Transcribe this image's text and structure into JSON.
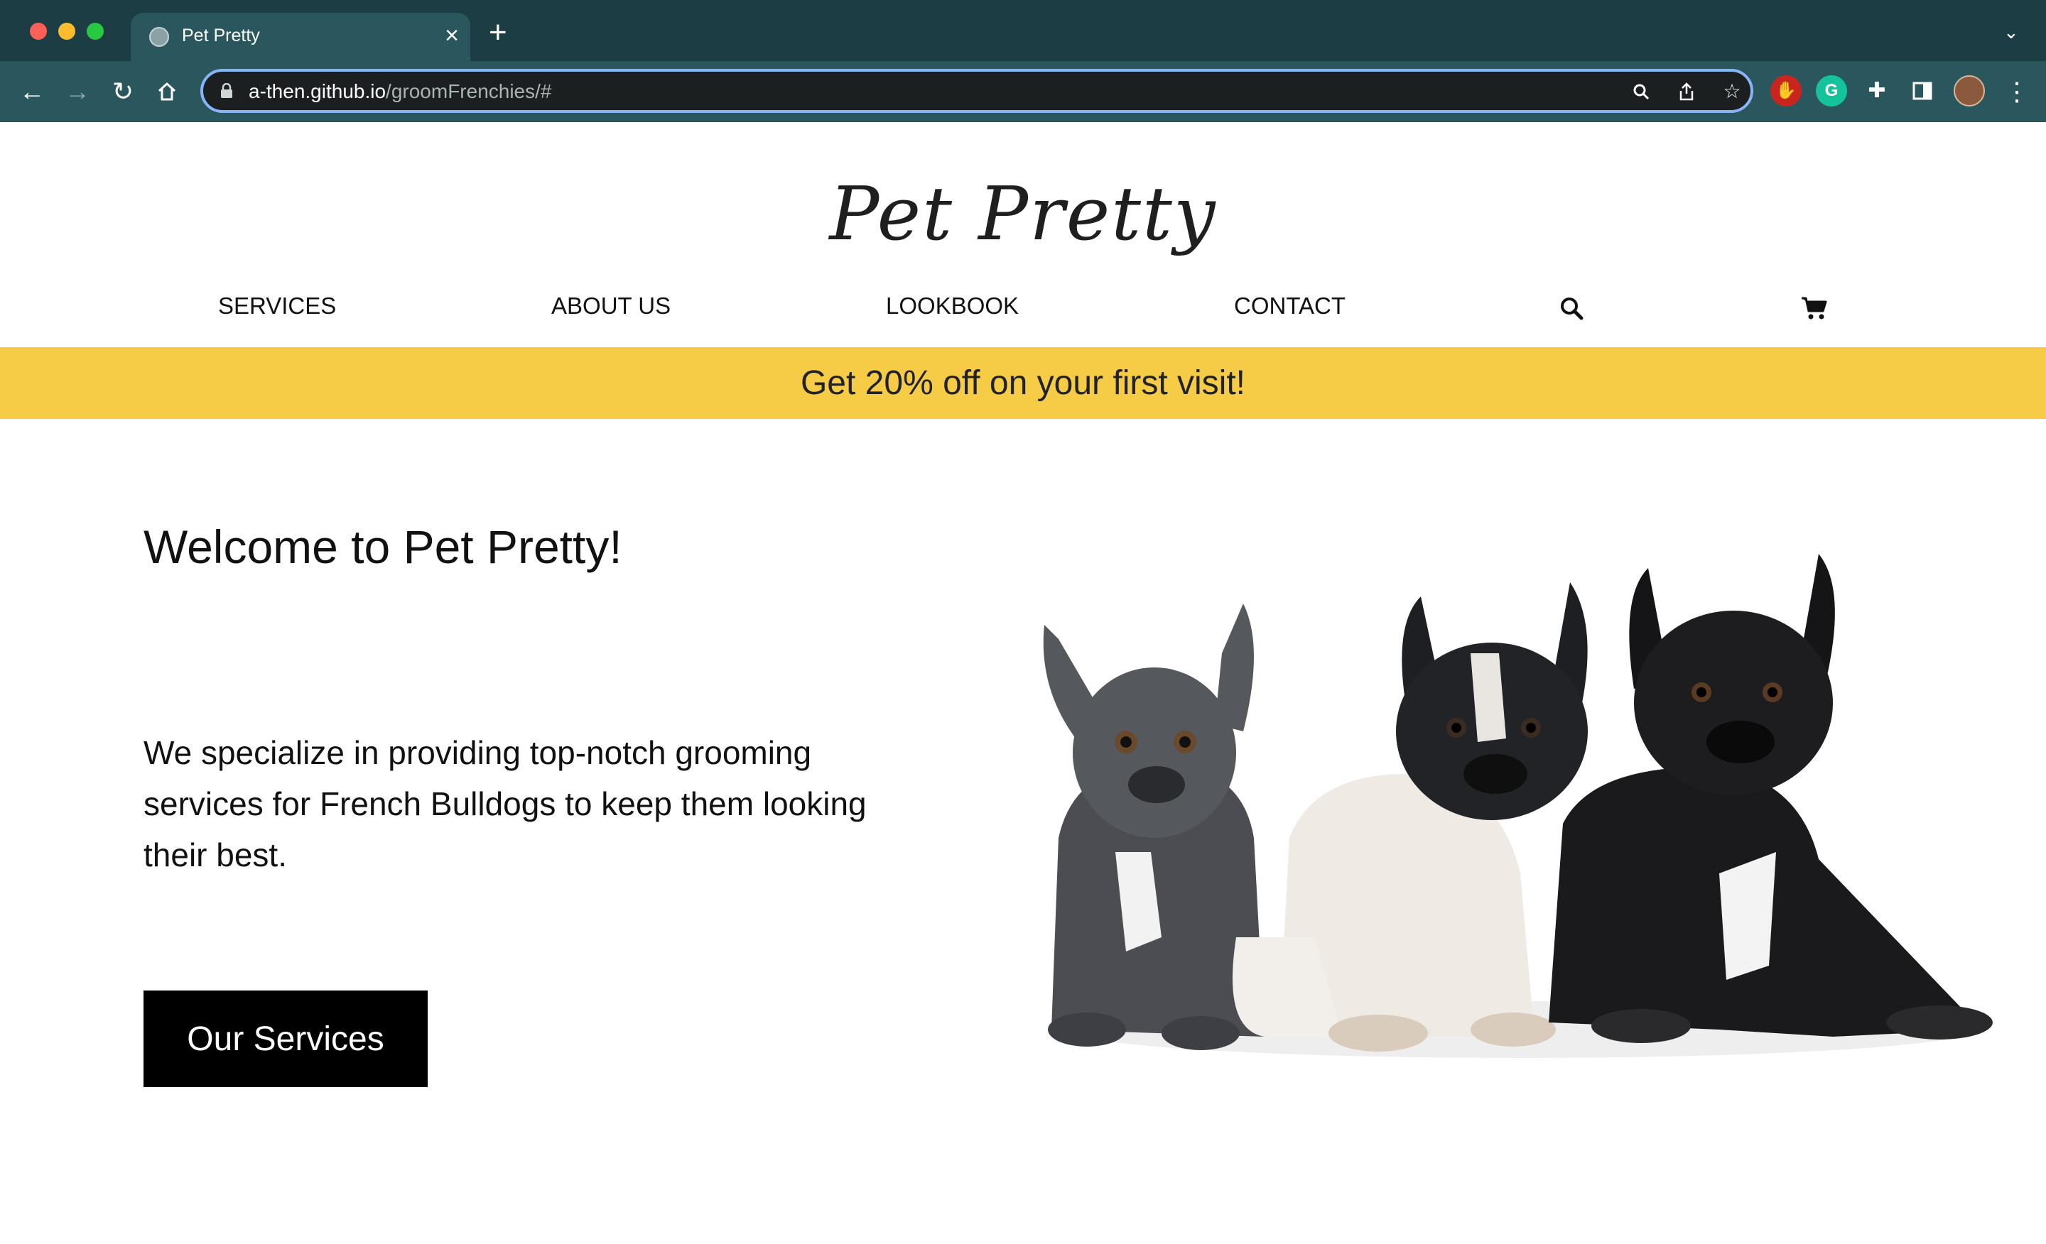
{
  "browser": {
    "tab_title": "Pet Pretty",
    "url_host": "a-then.github.io",
    "url_path": "/groomFrenchies/#",
    "extensions": [
      "adblock-icon",
      "grammarly-icon",
      "puzzle-icon",
      "sidepanel-icon",
      "profile-avatar"
    ]
  },
  "site": {
    "logo": "Pet Pretty",
    "nav": {
      "services": "SERVICES",
      "about": "ABOUT US",
      "lookbook": "LOOKBOOK",
      "contact": "CONTACT"
    },
    "promo": "Get 20% off on your first visit!",
    "hero": {
      "title": "Welcome to Pet Pretty!",
      "description": "We specialize in providing top-notch grooming services for French Bulldogs to keep them looking their best.",
      "cta": "Our Services"
    }
  },
  "colors": {
    "chrome_dark": "#1c3d43",
    "chrome_toolbar": "#2a575d",
    "promo_bar": "#f6cc46",
    "cta_background": "#000000"
  }
}
